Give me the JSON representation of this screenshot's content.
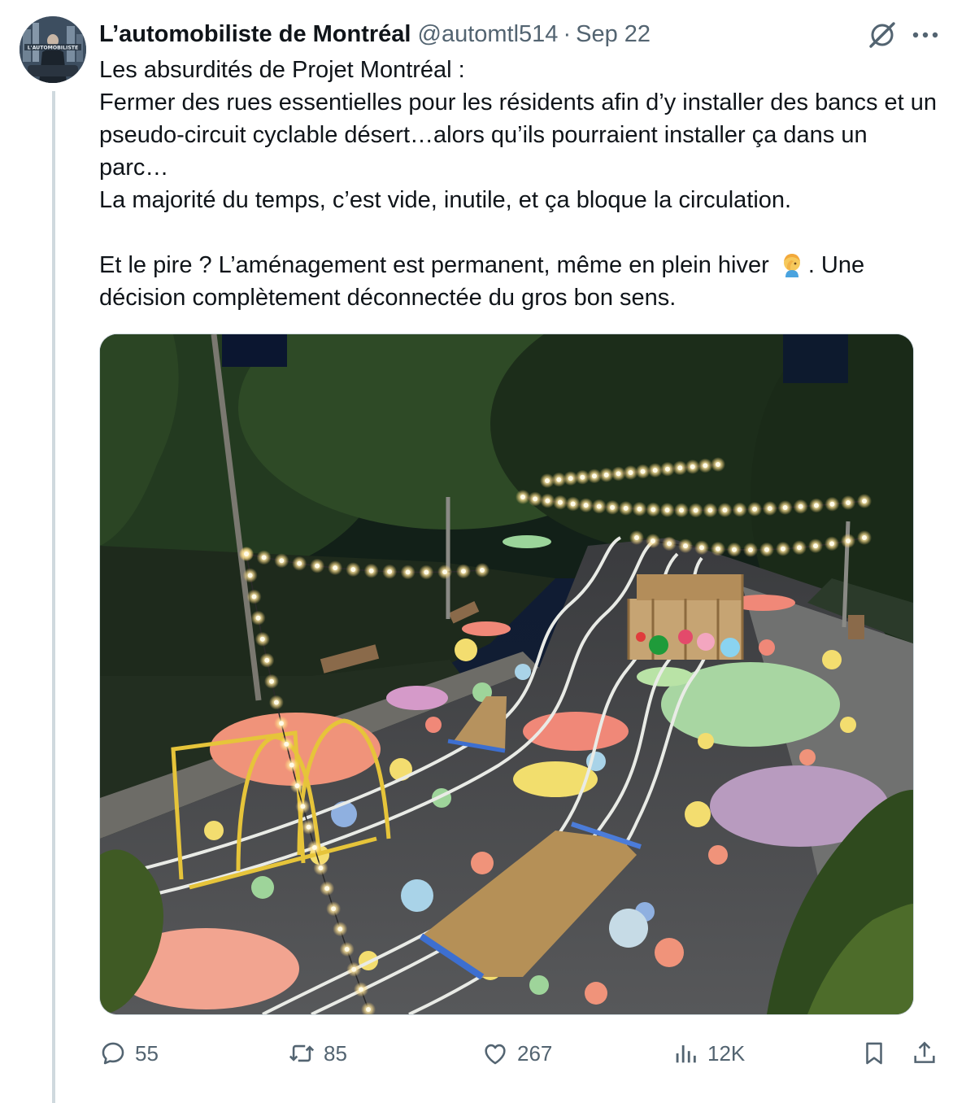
{
  "author": {
    "display_name": "L’automobiliste de Montréal",
    "handle": "@automtl514",
    "separator": "·",
    "date": "Sep 22",
    "avatar_text": "L'AUTOMOBILISTE"
  },
  "icons": {
    "grok": "grok-icon",
    "more": "more-icon",
    "reply": "reply-icon",
    "retweet": "retweet-icon",
    "like": "heart-icon",
    "views": "views-icon",
    "bookmark": "bookmark-icon",
    "share": "share-icon",
    "facepalm": "facepalm-emoji"
  },
  "text": {
    "line1": "Les absurdités de Projet Montréal :",
    "line2": "Fermer des rues essentielles pour les résidents afin d’y installer des bancs et un pseudo-circuit cyclable désert…alors qu’ils pourraient installer ça dans un parc…",
    "line3": "La majorité du temps, c’est vide, inutile, et ça bloque la circulation.",
    "line4_before": "Et le pire ? L’aménagement est permanent, même en plein hiver",
    "line4_after": ". Une décision complètement déconnectée du gros bon sens."
  },
  "media": {
    "description_hidden": ""
  },
  "stats": {
    "replies": "55",
    "retweets": "85",
    "likes": "267",
    "views": "12K"
  },
  "colors": {
    "text_primary": "#0f1419",
    "text_secondary": "#536471",
    "divider": "#cfd9de"
  }
}
